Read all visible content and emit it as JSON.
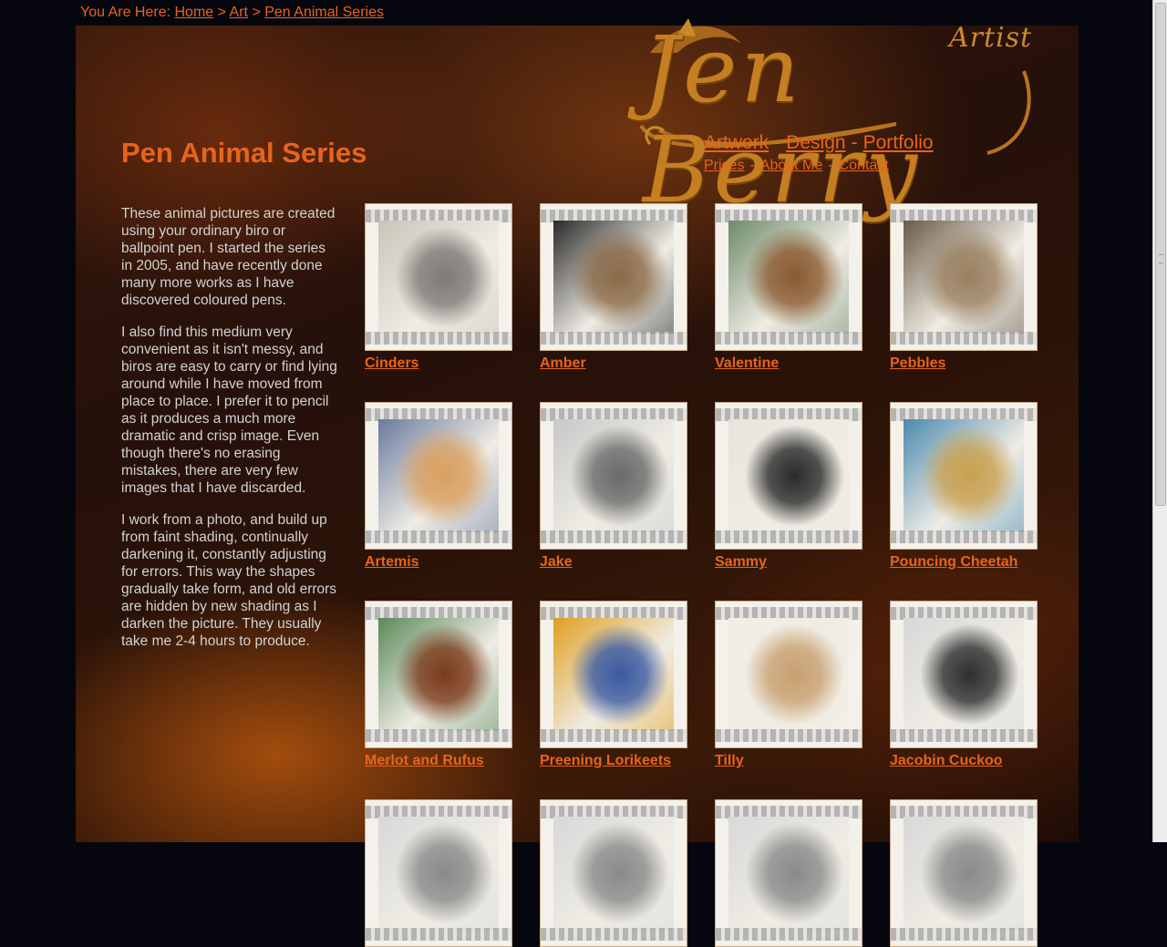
{
  "breadcrumb": {
    "prefix": "You Are Here:",
    "items": [
      "Home",
      "Art",
      "Pen Animal Series"
    ],
    "separator": ">"
  },
  "logo": {
    "name": "Jen Berry",
    "tag": "Artist"
  },
  "nav": {
    "main": [
      "Artwork",
      "Design",
      "Portfolio"
    ],
    "secondary": [
      "Prices",
      "About Me",
      "Contact"
    ],
    "separator": "-"
  },
  "page_title": "Pen Animal Series",
  "intro": [
    "These animal pictures are created using your ordinary biro or ballpoint pen. I started the series in 2005, and have recently done many more works as I have discovered coloured pens.",
    "I also find this medium very convenient as it isn't messy, and biros are easy to carry or find lying around while I have moved from place to place. I prefer it to pencil as it produces a much more dramatic and crisp image. Even though there's no erasing mistakes, there are very few images that I have discarded.",
    "I work from a photo, and build up from faint shading, continually darkening it, constantly adjusting for errors. This way the shapes gradually take form, and old errors are hidden by new shading as I darken the picture. They usually take me 2-4 hours to produce."
  ],
  "gallery": [
    {
      "title": "Cinders",
      "tone": "#7d7a76",
      "accent": "#c9c4b8"
    },
    {
      "title": "Amber",
      "tone": "#8a6a48",
      "accent": "#2a2a2a"
    },
    {
      "title": "Valentine",
      "tone": "#8a5a30",
      "accent": "#6e8a6a"
    },
    {
      "title": "Pebbles",
      "tone": "#9a8060",
      "accent": "#6a5a48"
    },
    {
      "title": "Artemis",
      "tone": "#d9a060",
      "accent": "#6a7aa0"
    },
    {
      "title": "Jake",
      "tone": "#6a6a6a",
      "accent": "#c8c8c8"
    },
    {
      "title": "Sammy",
      "tone": "#2a2a2a",
      "accent": "#e8e4dc"
    },
    {
      "title": "Pouncing Cheetah",
      "tone": "#c8a050",
      "accent": "#4a8ab0"
    },
    {
      "title": "Merlot and Rufus",
      "tone": "#7a3a1a",
      "accent": "#5a8a5a"
    },
    {
      "title": "Preening Lorikeets",
      "tone": "#3a5aa0",
      "accent": "#e0a020"
    },
    {
      "title": "Tilly",
      "tone": "#c8a070",
      "accent": "#f2eee6"
    },
    {
      "title": "Jacobin Cuckoo",
      "tone": "#2e2e2e",
      "accent": "#d8d8d8"
    },
    {
      "title": "",
      "tone": "#8a8a8a",
      "accent": "#d8d8d8"
    },
    {
      "title": "",
      "tone": "#8a8a8a",
      "accent": "#d8d8d8"
    },
    {
      "title": "",
      "tone": "#8a8a8a",
      "accent": "#d8d8d8"
    },
    {
      "title": "",
      "tone": "#8a8a8a",
      "accent": "#d8d8d8"
    }
  ]
}
